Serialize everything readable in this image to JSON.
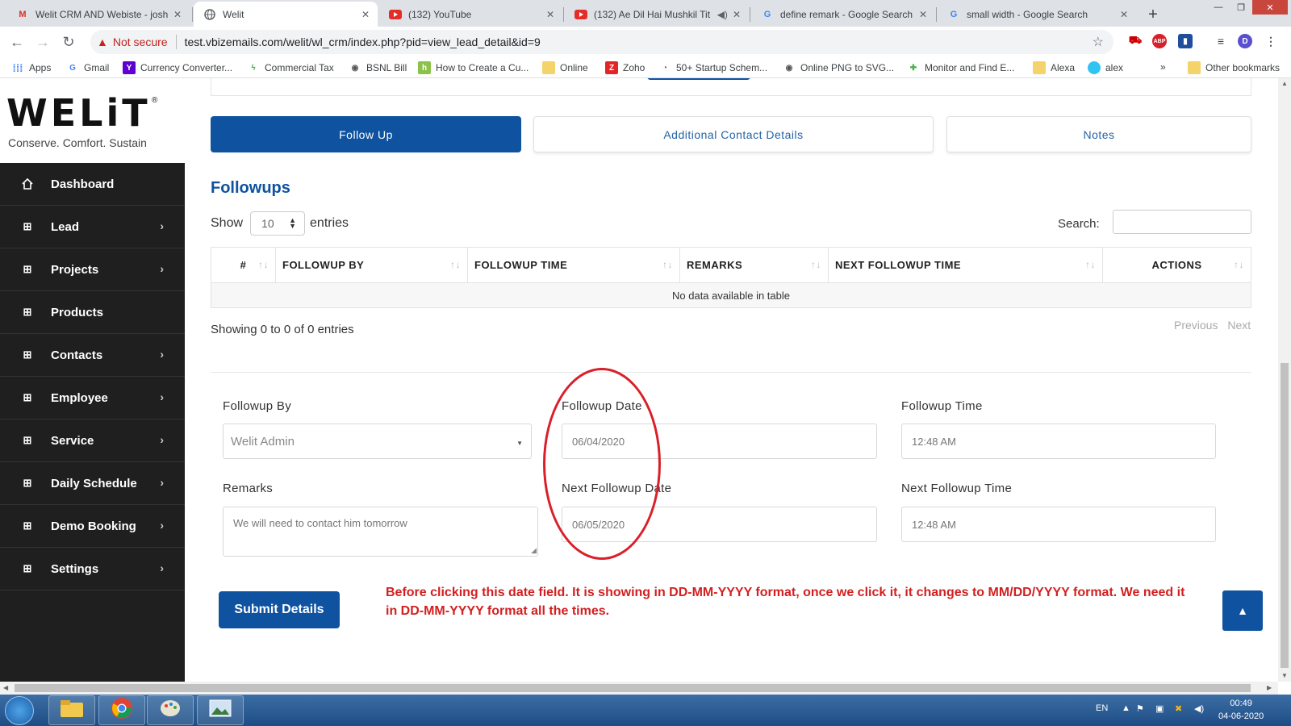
{
  "browser": {
    "tabs": [
      {
        "title": "Welit CRM AND Webiste - joshi",
        "icon": "gmail-icon",
        "active": false
      },
      {
        "title": "Welit",
        "icon": "globe-icon",
        "active": true
      },
      {
        "title": "(132) YouTube",
        "icon": "youtube-icon",
        "active": false
      },
      {
        "title": "(132) Ae Dil Hai Mushkil Tit",
        "icon": "youtube-icon",
        "active": false
      },
      {
        "title": "define remark - Google Search",
        "icon": "google-icon",
        "active": false
      },
      {
        "title": "small width - Google Search",
        "icon": "google-icon",
        "active": false
      }
    ],
    "security_label": "Not secure",
    "url": "test.vbizemails.com/welit/wl_crm/index.php?pid=view_lead_detail&id=9",
    "profile_initial": "D",
    "bookmarks": [
      "Apps",
      "Gmail",
      "Currency Converter...",
      "Commercial Tax",
      "BSNL Bill",
      "How to Create a Cu...",
      "Online",
      "Zoho",
      "50+ Startup Schem...",
      "Online PNG to SVG...",
      "Monitor and Find E...",
      "Alexa",
      "alex"
    ],
    "bookmarks_more": "»",
    "other_bookmarks": "Other bookmarks"
  },
  "sidebar": {
    "logo_text": "WELiT",
    "logo_reg": "®",
    "tagline": "Conserve. Comfort. Sustain",
    "items": [
      {
        "label": "Dashboard",
        "icon": "home-icon",
        "has_children": false
      },
      {
        "label": "Lead",
        "icon": "grid-icon",
        "has_children": true
      },
      {
        "label": "Projects",
        "icon": "grid-icon",
        "has_children": true
      },
      {
        "label": "Products",
        "icon": "grid-icon",
        "has_children": false
      },
      {
        "label": "Contacts",
        "icon": "grid-icon",
        "has_children": true
      },
      {
        "label": "Employee",
        "icon": "grid-icon",
        "has_children": true
      },
      {
        "label": "Service",
        "icon": "grid-icon",
        "has_children": true
      },
      {
        "label": "Daily Schedule",
        "icon": "grid-icon",
        "has_children": true
      },
      {
        "label": "Demo Booking",
        "icon": "grid-icon",
        "has_children": true
      },
      {
        "label": "Settings",
        "icon": "grid-icon",
        "has_children": true
      }
    ]
  },
  "main": {
    "tabs": [
      {
        "label": "Follow Up",
        "active": true
      },
      {
        "label": "Additional Contact Details",
        "active": false
      },
      {
        "label": "Notes",
        "active": false
      }
    ],
    "section_title": "Followups",
    "show_label": "Show",
    "entries_value": "10",
    "entries_label": "entries",
    "search_label": "Search:",
    "table": {
      "columns": [
        "#",
        "FOLLOWUP BY",
        "FOLLOWUP TIME",
        "REMARKS",
        "NEXT FOLLOWUP TIME",
        "ACTIONS"
      ],
      "empty_message": "No data available in table"
    },
    "info": "Showing 0 to 0 of 0 entries",
    "pager": {
      "previous": "Previous",
      "next": "Next"
    },
    "form": {
      "followup_by": {
        "label": "Followup By",
        "value": "Welit Admin"
      },
      "followup_date": {
        "label": "Followup Date",
        "value": "06/04/2020"
      },
      "followup_time": {
        "label": "Followup Time",
        "value": "12:48 AM"
      },
      "remarks": {
        "label": "Remarks",
        "value": "We will need to contact him tomorrow"
      },
      "next_followup_date": {
        "label": "Next Followup Date",
        "value": "06/05/2020"
      },
      "next_followup_time": {
        "label": "Next Followup Time",
        "value": "12:48 AM"
      }
    },
    "submit_label": "Submit Details",
    "annotation": "Before clicking this date field. It is showing in DD-MM-YYYY format, once we click it, it changes to MM/DD/YYYY format. We need it in DD-MM-YYYY format all the times."
  },
  "taskbar": {
    "language": "EN",
    "time": "00:49",
    "date": "04-06-2020"
  },
  "colors": {
    "accent": "#0e52a0",
    "sidebar_bg": "#1f1f1f",
    "annotation_red": "#d31f1f"
  }
}
